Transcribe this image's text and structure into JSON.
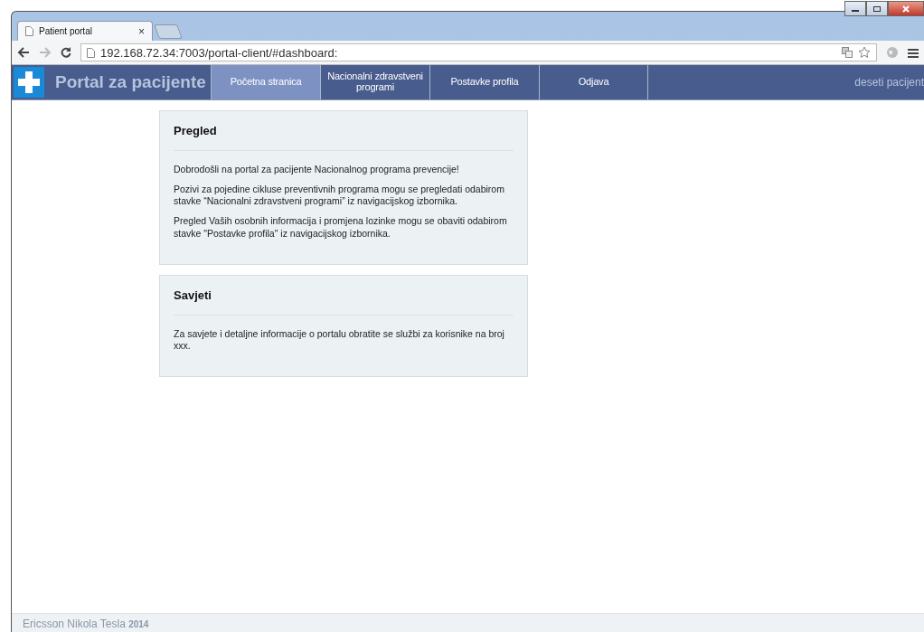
{
  "browser": {
    "tab_title": "Patient portal",
    "tab_close": "×",
    "url": "192.168.72.34:7003/portal-client/#dashboard:"
  },
  "app": {
    "title": "Portal za pacijente",
    "user": "deseti pacijent"
  },
  "nav": [
    {
      "label": "Početna stranica",
      "selected": true
    },
    {
      "label": "Nacionalni zdravstveni programi",
      "selected": false
    },
    {
      "label": "Postavke profila",
      "selected": false
    },
    {
      "label": "Odjava",
      "selected": false
    }
  ],
  "panels": [
    {
      "title": "Pregled",
      "paragraphs": [
        "Dobrodošli na portal za pacijente Nacionalnog programa prevencije!",
        "Pozivi za pojedine cikluse preventivnih programa mogu se pregledati odabirom stavke “Nacionalni zdravstveni programi” iz navigacijskog izbornika.",
        "Pregled Vaših osobnih informacija i promjena lozinke mogu se obaviti odabirom stavke \"Postavke profila\" iz navigacijskog izbornika."
      ]
    },
    {
      "title": "Savjeti",
      "paragraphs": [
        "Za savjete i detaljne informacije o portalu obratite se službi za korisnike na broj xxx."
      ]
    }
  ],
  "footer": "Ericsson Nikola Tesla **2014**"
}
